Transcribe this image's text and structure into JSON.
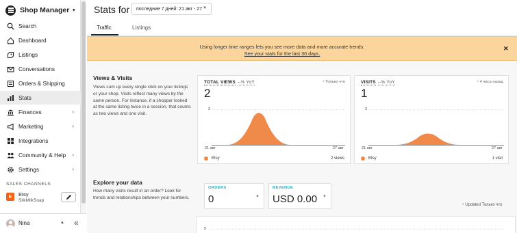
{
  "app": {
    "title": "Shop Manager"
  },
  "sidebar": {
    "items": [
      {
        "label": "Search",
        "icon": "search-icon"
      },
      {
        "label": "Dashboard",
        "icon": "home-icon"
      },
      {
        "label": "Listings",
        "icon": "listings-icon"
      },
      {
        "label": "Conversations",
        "icon": "mail-icon"
      },
      {
        "label": "Orders & Shipping",
        "icon": "orders-icon"
      },
      {
        "label": "Stats",
        "icon": "stats-icon",
        "active": true
      },
      {
        "label": "Finances",
        "icon": "finances-icon",
        "has_submenu": true
      },
      {
        "label": "Marketing",
        "icon": "megaphone-icon",
        "has_submenu": true
      },
      {
        "label": "Integrations",
        "icon": "grid-icon"
      },
      {
        "label": "Community & Help",
        "icon": "people-icon",
        "has_submenu": true
      },
      {
        "label": "Settings",
        "icon": "gear-icon",
        "has_submenu": true
      }
    ],
    "sales_channels_label": "SALES CHANNELS",
    "channel": {
      "badge": "E",
      "name": "Etsy",
      "shop": "SilkMilkSoap"
    },
    "user": {
      "name": "Nina"
    }
  },
  "header": {
    "title": "Stats for",
    "date_range": "последние 7 дней: 21 авг - 27"
  },
  "tabs": [
    {
      "label": "Traffic",
      "active": true
    },
    {
      "label": "Listings",
      "active": false
    }
  ],
  "banner": {
    "text": "Using longer time ranges lets you see more data and more accurate trends.",
    "link": "See your stats for the last 30 days."
  },
  "views_visits": {
    "heading": "Views & Visits",
    "description": "Views sum up every single click on your listings or your shop. Visits reflect many views by the same person. For instance, if a shopper looked at the same listing twice in a session, that counts as two views and one visit."
  },
  "panels": [
    {
      "label": "TOTAL VIEWS",
      "yoy": "--% YoY",
      "meta": "Только что",
      "value": "2",
      "y_tick": "3",
      "x_start": "21 авг",
      "x_end": "27 авг",
      "legend": "Etsy",
      "total": "2 views"
    },
    {
      "label": "VISITS",
      "yoy": "--% YoY",
      "meta": "4 часа назад",
      "value": "1",
      "y_tick": "3",
      "x_start": "21 авг",
      "x_end": "27 авг",
      "legend": "Etsy",
      "total": "1 visit"
    }
  ],
  "explore": {
    "heading": "Explore your data",
    "description": "How many visits result in an order? Look for trends and relationships between your numbers.",
    "orders": {
      "label": "ORDERS",
      "value": "0"
    },
    "revenue": {
      "label": "REVENUE",
      "value": "USD 0.00"
    },
    "updated": "Updated Только что",
    "y_tick": "5"
  },
  "colors": {
    "accent_orange": "#f08a4b",
    "banner": "#fbd59b",
    "teal": "#2fb1c3"
  },
  "chart_data": [
    {
      "type": "area",
      "title": "TOTAL VIEWS",
      "x": [
        "21 авг",
        "27 авг"
      ],
      "series": [
        {
          "name": "Etsy",
          "total": 2
        }
      ],
      "ylim": [
        0,
        3
      ]
    },
    {
      "type": "area",
      "title": "VISITS",
      "x": [
        "21 авг",
        "27 авг"
      ],
      "series": [
        {
          "name": "Etsy",
          "total": 1
        }
      ],
      "ylim": [
        0,
        3
      ]
    }
  ]
}
